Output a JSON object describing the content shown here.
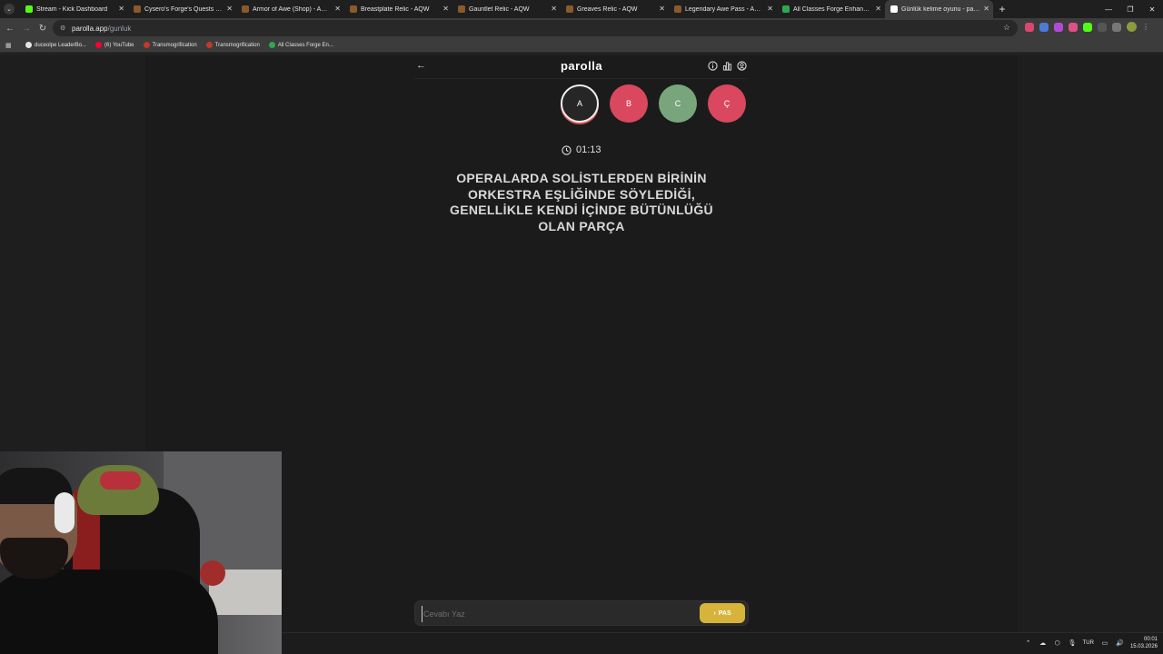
{
  "browser": {
    "tabs": [
      {
        "title": "Stream - Kick Dashboard",
        "favicon_color": "#53fc18"
      },
      {
        "title": "Cysero's Forge's Quests - AQW",
        "favicon_color": "#8a5a2b"
      },
      {
        "title": "Armor of Awe (Shop) - AQW",
        "favicon_color": "#8a5a2b"
      },
      {
        "title": "Breastplate Relic - AQW",
        "favicon_color": "#8a5a2b"
      },
      {
        "title": "Gauntlet Relic - AQW",
        "favicon_color": "#8a5a2b"
      },
      {
        "title": "Greaves Relic - AQW",
        "favicon_color": "#8a5a2b"
      },
      {
        "title": "Legendary Awe Pass - AQW",
        "favicon_color": "#8a5a2b"
      },
      {
        "title": "All Classes Forge Enhancements",
        "favicon_color": "#2fa84f"
      },
      {
        "title": "Günlük kelime oyunu - parolla",
        "favicon_color": "#ffffff",
        "active": true
      }
    ],
    "url_host": "parolla.app",
    "url_path": "/gunluk",
    "bookmarks": [
      {
        "label": "duceolpe LeaderBo...",
        "icon_color": "#e3e3e3"
      },
      {
        "label": "(6) YouTube",
        "icon_color": "#ff0033"
      },
      {
        "label": "Transmogrification",
        "icon_color": "#c0392b"
      },
      {
        "label": "Transmogrification",
        "icon_color": "#c0392b"
      },
      {
        "label": "All Classes Forge En...",
        "icon_color": "#2fa84f"
      }
    ]
  },
  "app": {
    "logo": "parolla",
    "letters": [
      {
        "label": "A",
        "state": "active"
      },
      {
        "label": "B",
        "state": "wrong"
      },
      {
        "label": "C",
        "state": "right"
      },
      {
        "label": "Ç",
        "state": "wrong"
      }
    ],
    "timer": "01:13",
    "question": "OPERALARDA SOLİSTLERDEN BİRİNİN ORKESTRA EŞLİĞİNDE SÖYLEDİĞİ, GENELLİKLE KENDİ İÇİNDE BÜTÜNLÜĞÜ OLAN PARÇA",
    "answer_placeholder": "Cevabı Yaz",
    "pass_label": "PAS",
    "colors": {
      "pass": "#d7b33a",
      "wrong": "#d9485f",
      "right": "#79a57c"
    }
  },
  "taskbar": {
    "language": "TUR",
    "time": "00:01",
    "date": "15.03.2026"
  }
}
